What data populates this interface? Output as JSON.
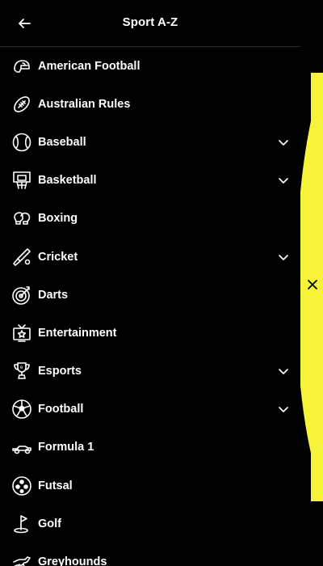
{
  "header": {
    "title": "Sport A-Z",
    "back_icon": "arrow-left-icon"
  },
  "close_icon": "close-icon",
  "accent_color": "#f7f33a",
  "sports": [
    {
      "label": "American Football",
      "icon": "american-football-helmet-icon",
      "expandable": false
    },
    {
      "label": "Australian Rules",
      "icon": "australian-rules-ball-icon",
      "expandable": false
    },
    {
      "label": "Baseball",
      "icon": "baseball-icon",
      "expandable": true
    },
    {
      "label": "Basketball",
      "icon": "basketball-hoop-icon",
      "expandable": true
    },
    {
      "label": "Boxing",
      "icon": "boxing-gloves-icon",
      "expandable": false
    },
    {
      "label": "Cricket",
      "icon": "cricket-bat-icon",
      "expandable": true
    },
    {
      "label": "Darts",
      "icon": "darts-target-icon",
      "expandable": false
    },
    {
      "label": "Entertainment",
      "icon": "tv-star-icon",
      "expandable": false
    },
    {
      "label": "Esports",
      "icon": "esports-trophy-icon",
      "expandable": true
    },
    {
      "label": "Football",
      "icon": "soccer-ball-icon",
      "expandable": true
    },
    {
      "label": "Formula 1",
      "icon": "formula-car-icon",
      "expandable": false
    },
    {
      "label": "Futsal",
      "icon": "futsal-ball-icon",
      "expandable": false
    },
    {
      "label": "Golf",
      "icon": "golf-flag-icon",
      "expandable": false
    },
    {
      "label": "Greyhounds",
      "icon": "greyhound-icon",
      "expandable": false
    }
  ]
}
